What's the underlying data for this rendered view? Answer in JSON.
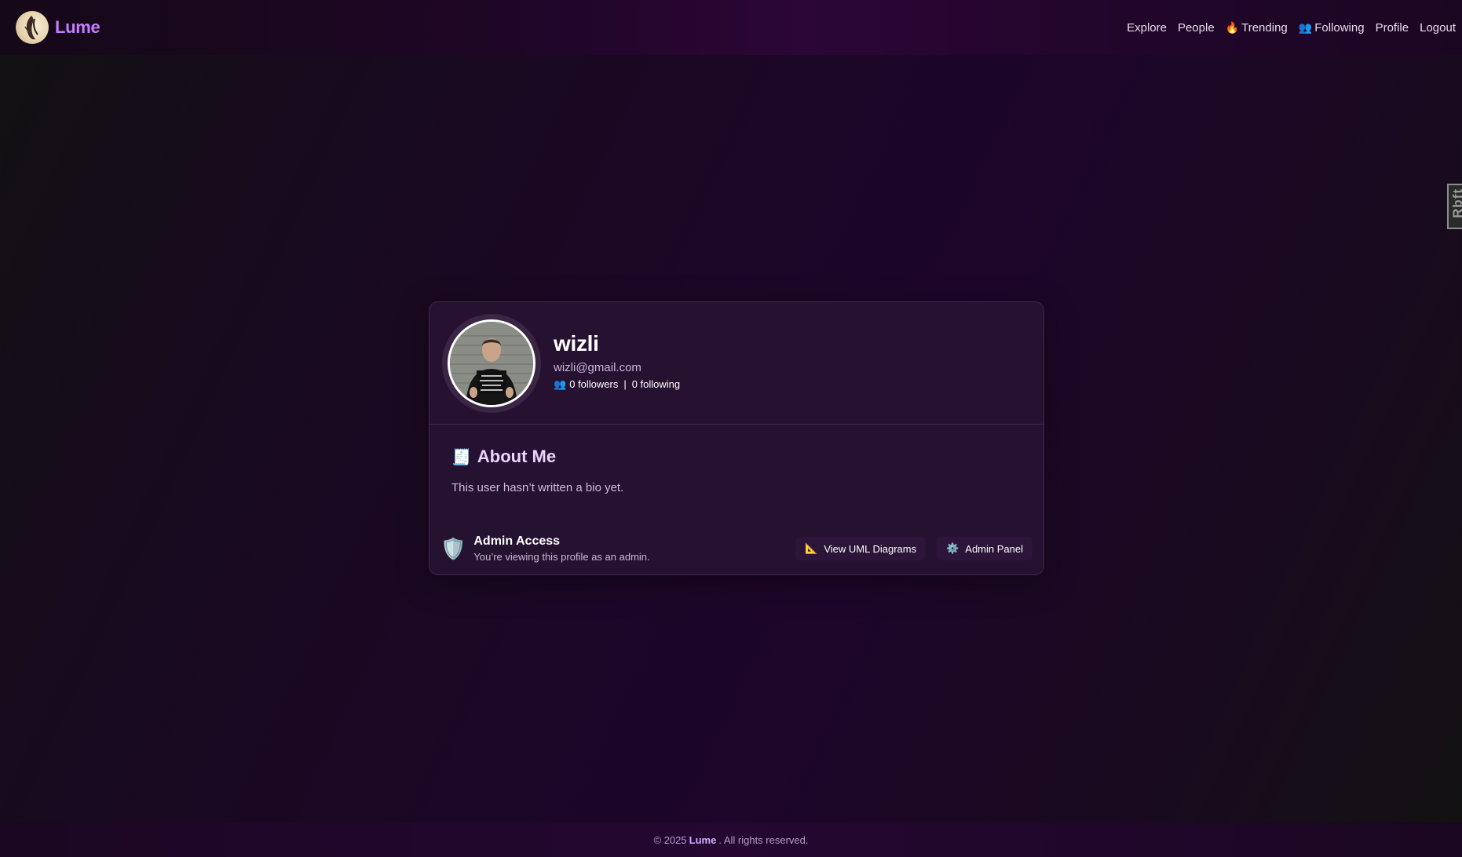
{
  "header": {
    "brand": "Lume",
    "nav": [
      {
        "label": "Explore",
        "icon": ""
      },
      {
        "label": "People",
        "icon": ""
      },
      {
        "label": "Trending",
        "icon": "🔥"
      },
      {
        "label": "Following",
        "icon": "👥"
      },
      {
        "label": "Profile",
        "icon": ""
      },
      {
        "label": "Logout",
        "icon": ""
      }
    ]
  },
  "side_tab": {
    "label": "Rbft"
  },
  "profile": {
    "username": "wizli",
    "email": "wizli@gmail.com",
    "followers_icon": "👥",
    "followers": "0 followers",
    "separator": "|",
    "following": "0 following"
  },
  "about": {
    "icon": "🧾",
    "title": "About Me",
    "bio": "This user hasn’t written a bio yet."
  },
  "admin": {
    "icon": "🛡️",
    "title": "Admin Access",
    "subtitle": "You’re viewing this profile as an admin.",
    "buttons": [
      {
        "icon": "📐",
        "label": "View UML Diagrams"
      },
      {
        "icon": "⚙️",
        "label": "Admin Panel"
      }
    ]
  },
  "footer": {
    "prefix": "© 2025",
    "brand": "Lume",
    "suffix": ". All rights reserved."
  },
  "colors": {
    "accent": "#c77dff",
    "card_bg": "#261230",
    "page_bg": "#1b0726"
  }
}
